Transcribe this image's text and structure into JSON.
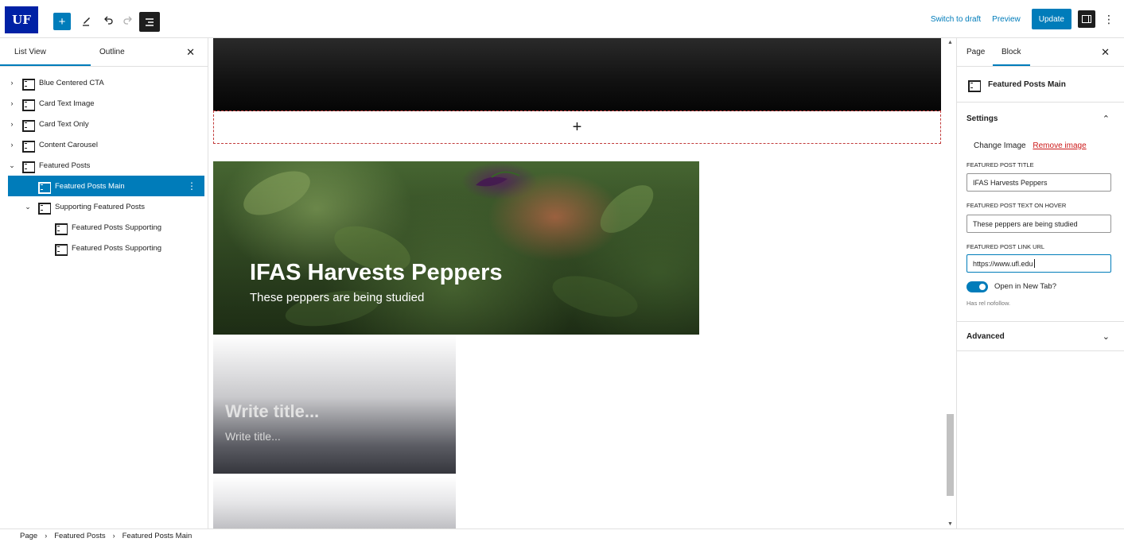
{
  "toolbar": {
    "logo": "UF",
    "add_icon": "+",
    "switch_to_draft": "Switch to draft",
    "preview": "Preview",
    "update": "Update"
  },
  "left_sidebar": {
    "tabs": [
      "List View",
      "Outline"
    ],
    "active_tab": "List View",
    "items": [
      {
        "label": "Blue Centered CTA",
        "level": 1,
        "expanded": false
      },
      {
        "label": "Card Text Image",
        "level": 1,
        "expanded": false
      },
      {
        "label": "Card Text Only",
        "level": 1,
        "expanded": false
      },
      {
        "label": "Content Carousel",
        "level": 1,
        "expanded": false
      },
      {
        "label": "Featured Posts",
        "level": 1,
        "expanded": true
      },
      {
        "label": "Featured Posts Main",
        "level": 2,
        "selected": true
      },
      {
        "label": "Supporting Featured Posts",
        "level": 2,
        "expanded": true
      },
      {
        "label": "Featured Posts Supporting",
        "level": 3
      },
      {
        "label": "Featured Posts Supporting",
        "level": 3
      }
    ]
  },
  "canvas": {
    "appender_symbol": "+",
    "hero": {
      "title": "IFAS Harvests Peppers",
      "subtitle": "These peppers are being studied"
    },
    "card1": {
      "title": "Write title...",
      "subtitle": "Write title..."
    }
  },
  "right_sidebar": {
    "tabs": [
      "Page",
      "Block"
    ],
    "active_tab": "Block",
    "block_name": "Featured Posts Main",
    "settings_label": "Settings",
    "change_image": "Change Image",
    "remove_image": "Remove image",
    "fields": {
      "title_label": "FEATURED POST TITLE",
      "title_value": "IFAS Harvests Peppers",
      "hover_label": "FEATURED POST TEXT ON HOVER",
      "hover_value": "These peppers are being studied",
      "url_label": "FEATURED POST LINK URL",
      "url_value": "https://www.ufl.edu"
    },
    "new_tab_label": "Open in New Tab?",
    "new_tab_on": true,
    "rel_help": "Has rel nofollow.",
    "advanced_label": "Advanced"
  },
  "breadcrumb": [
    "Page",
    "Featured Posts",
    "Featured Posts Main"
  ],
  "colors": {
    "accent": "#007cba",
    "logo_bg": "#0021a5",
    "remove": "#cc1818"
  }
}
